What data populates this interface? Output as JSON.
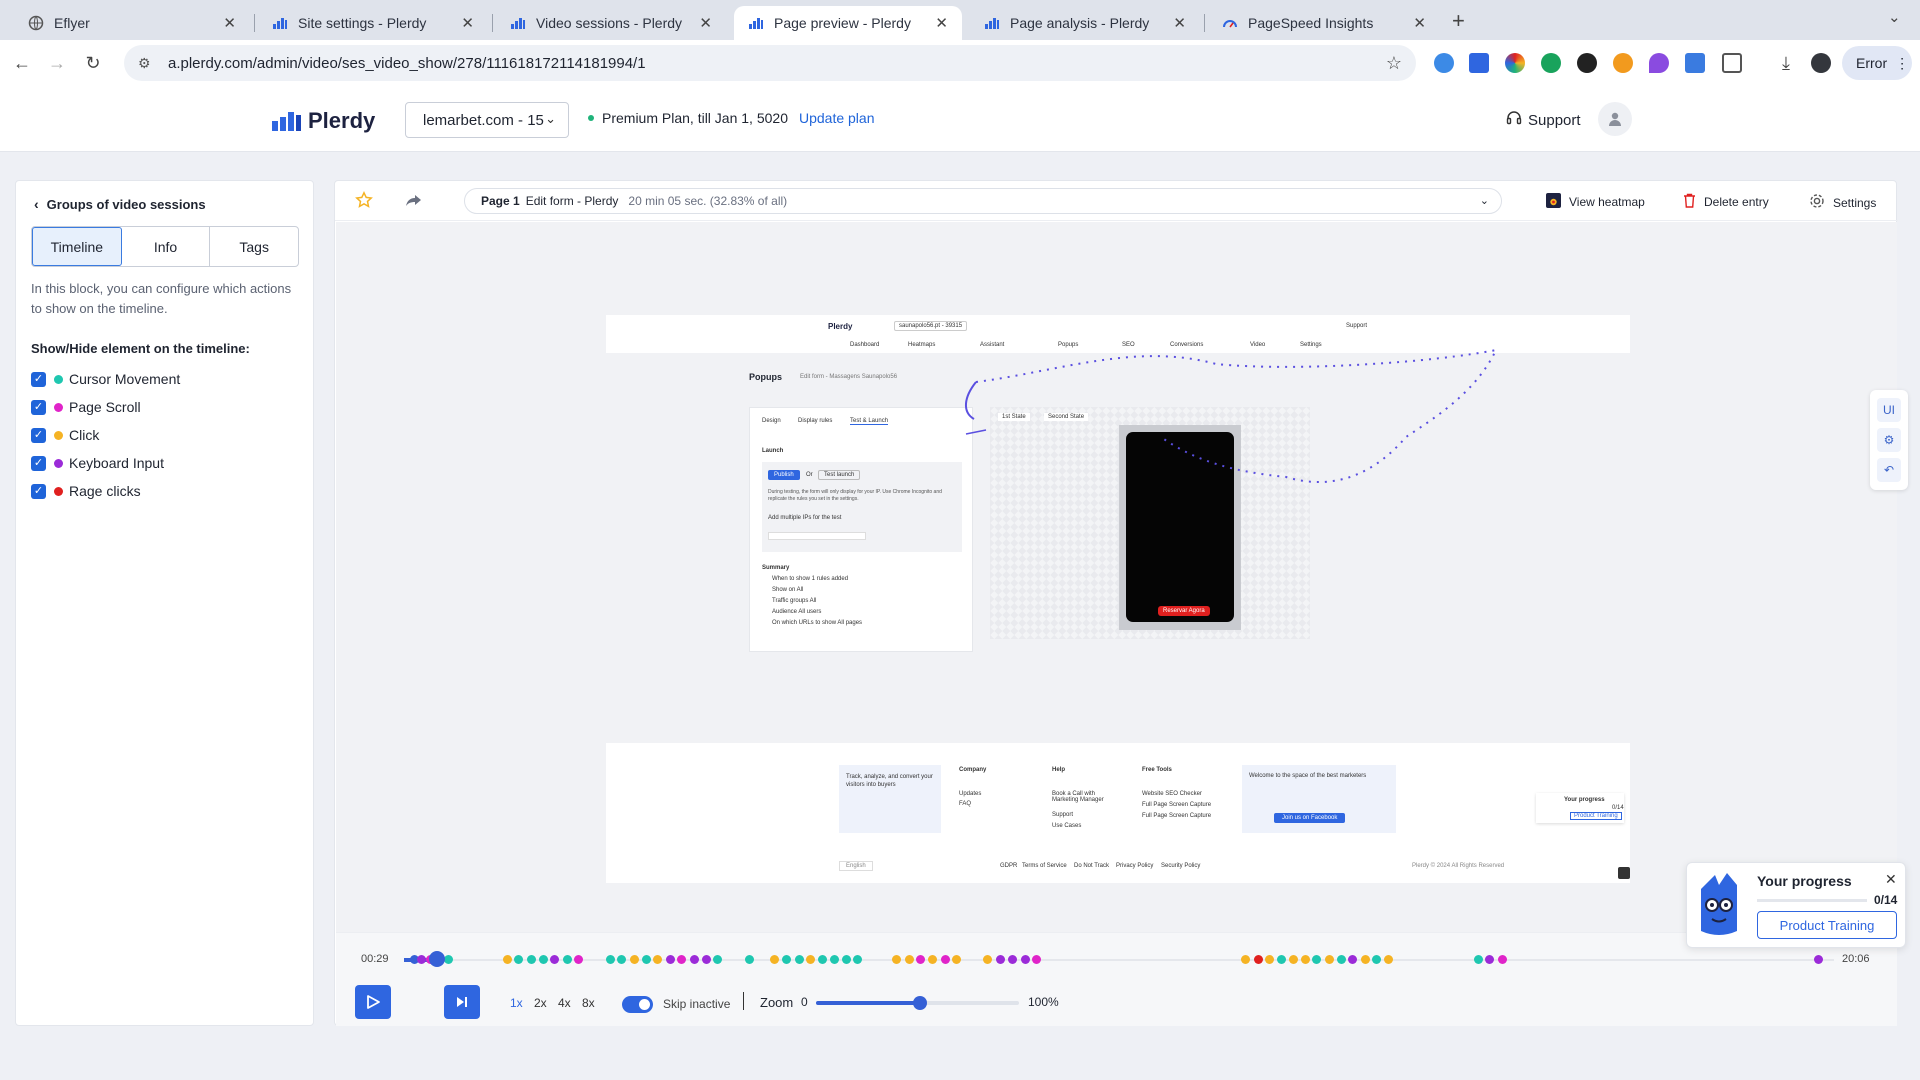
{
  "browser": {
    "tabs": [
      {
        "title": "Eflyer"
      },
      {
        "title": "Site settings - Plerdy"
      },
      {
        "title": "Video sessions - Plerdy"
      },
      {
        "title": "Page preview - Plerdy"
      },
      {
        "title": "Page analysis - Plerdy"
      },
      {
        "title": "PageSpeed Insights"
      }
    ],
    "url": "a.plerdy.com/admin/video/ses_video_show/278/111618172114181994/1",
    "profile_status": "Error"
  },
  "header": {
    "logo": "Plerdy",
    "site": "lemarbet.com - 15",
    "plan": "Premium Plan, till Jan 1, 5020",
    "update_plan": "Update plan",
    "support": "Support"
  },
  "sidebar": {
    "back_label": "Groups of video sessions",
    "tabs": [
      "Timeline",
      "Info",
      "Tags"
    ],
    "description": "In this block, you can configure which actions to show on the timeline.",
    "section_title": "Show/Hide element on the timeline:",
    "items": [
      {
        "label": "Cursor Movement",
        "color": "#1fc7b0"
      },
      {
        "label": "Page Scroll",
        "color": "#e024c9"
      },
      {
        "label": "Click",
        "color": "#f5b324"
      },
      {
        "label": "Keyboard Input",
        "color": "#9b2bd8"
      },
      {
        "label": "Rage clicks",
        "color": "#e0201f"
      }
    ]
  },
  "player": {
    "page_num": "Page 1",
    "page_title": "Edit form - Plerdy",
    "duration": "20 min 05 sec. (32.83% of all)",
    "view_heatmap": "View heatmap",
    "delete_entry": "Delete entry",
    "settings": "Settings",
    "time_current": "00:29",
    "time_total": "20:06",
    "speeds": [
      "1x",
      "2x",
      "4x",
      "8x"
    ],
    "skip_inactive": "Skip inactive",
    "zoom_label": "Zoom",
    "zoom_min": "0",
    "zoom_max": "100%",
    "zoom_level": 0.51,
    "timeline_events": [
      {
        "t": 0.007,
        "c": "#3560d6"
      },
      {
        "t": 0.012,
        "c": "#9b2bd8"
      },
      {
        "t": 0.018,
        "c": "#e024c9"
      },
      {
        "t": 0.031,
        "c": "#1fc7b0"
      },
      {
        "t": 0.072,
        "c": "#f5b324"
      },
      {
        "t": 0.08,
        "c": "#1fc7b0"
      },
      {
        "t": 0.089,
        "c": "#1fc7b0"
      },
      {
        "t": 0.097,
        "c": "#1fc7b0"
      },
      {
        "t": 0.105,
        "c": "#9b2bd8"
      },
      {
        "t": 0.114,
        "c": "#1fc7b0"
      },
      {
        "t": 0.122,
        "c": "#e024c9"
      },
      {
        "t": 0.144,
        "c": "#1fc7b0"
      },
      {
        "t": 0.152,
        "c": "#1fc7b0"
      },
      {
        "t": 0.161,
        "c": "#f5b324"
      },
      {
        "t": 0.169,
        "c": "#1fc7b0"
      },
      {
        "t": 0.177,
        "c": "#f5b324"
      },
      {
        "t": 0.186,
        "c": "#9b2bd8"
      },
      {
        "t": 0.194,
        "c": "#e024c9"
      },
      {
        "t": 0.203,
        "c": "#9b2bd8"
      },
      {
        "t": 0.211,
        "c": "#9b2bd8"
      },
      {
        "t": 0.219,
        "c": "#1fc7b0"
      },
      {
        "t": 0.241,
        "c": "#1fc7b0"
      },
      {
        "t": 0.259,
        "c": "#f5b324"
      },
      {
        "t": 0.267,
        "c": "#1fc7b0"
      },
      {
        "t": 0.276,
        "c": "#1fc7b0"
      },
      {
        "t": 0.284,
        "c": "#f5b324"
      },
      {
        "t": 0.292,
        "c": "#1fc7b0"
      },
      {
        "t": 0.301,
        "c": "#1fc7b0"
      },
      {
        "t": 0.309,
        "c": "#1fc7b0"
      },
      {
        "t": 0.317,
        "c": "#1fc7b0"
      },
      {
        "t": 0.344,
        "c": "#f5b324"
      },
      {
        "t": 0.353,
        "c": "#f5b324"
      },
      {
        "t": 0.361,
        "c": "#e024c9"
      },
      {
        "t": 0.369,
        "c": "#f5b324"
      },
      {
        "t": 0.378,
        "c": "#e024c9"
      },
      {
        "t": 0.386,
        "c": "#f5b324"
      },
      {
        "t": 0.408,
        "c": "#f5b324"
      },
      {
        "t": 0.417,
        "c": "#9b2bd8"
      },
      {
        "t": 0.425,
        "c": "#9b2bd8"
      },
      {
        "t": 0.434,
        "c": "#9b2bd8"
      },
      {
        "t": 0.442,
        "c": "#e024c9"
      },
      {
        "t": 0.588,
        "c": "#f5b324"
      },
      {
        "t": 0.597,
        "c": "#e0201f"
      },
      {
        "t": 0.605,
        "c": "#f5b324"
      },
      {
        "t": 0.613,
        "c": "#1fc7b0"
      },
      {
        "t": 0.622,
        "c": "#f5b324"
      },
      {
        "t": 0.63,
        "c": "#f5b324"
      },
      {
        "t": 0.638,
        "c": "#1fc7b0"
      },
      {
        "t": 0.647,
        "c": "#f5b324"
      },
      {
        "t": 0.655,
        "c": "#1fc7b0"
      },
      {
        "t": 0.663,
        "c": "#9b2bd8"
      },
      {
        "t": 0.672,
        "c": "#f5b324"
      },
      {
        "t": 0.68,
        "c": "#1fc7b0"
      },
      {
        "t": 0.688,
        "c": "#f5b324"
      },
      {
        "t": 0.751,
        "c": "#1fc7b0"
      },
      {
        "t": 0.759,
        "c": "#9b2bd8"
      },
      {
        "t": 0.768,
        "c": "#e024c9"
      },
      {
        "t": 0.989,
        "c": "#9b2bd8"
      }
    ]
  },
  "preview": {
    "logo": "Plerdy",
    "site": "saunapolo56.pt - 39315",
    "support": "Support",
    "nav": [
      "Dashboard",
      "Heatmaps",
      "Assistant",
      "Popups",
      "SEO",
      "Conversions",
      "Video",
      "Settings"
    ],
    "section": "Popups",
    "breadcrumb": "Edit form - Massagens Saunapolo56",
    "form_tabs": [
      "Design",
      "Display rules",
      "Test & Launch"
    ],
    "launch": "Launch",
    "publish": "Publish",
    "or": "Or",
    "test_launch": "Test launch",
    "launch_desc": "During testing, the form will only display for your IP. Use Chrome Incognito and replicate the rules you set in the settings.",
    "multi_ip": "Add multiple IPs for the test",
    "summary": "Summary",
    "summary_items": [
      "When to show 1 rules added",
      "Show on All",
      "Traffic groups All",
      "Audience All users",
      "On which URLs to show All pages"
    ],
    "state_tabs": [
      "1st State",
      "Second State"
    ],
    "cta": "Reservar Agora",
    "footer_promo": "Track, analyze, and convert your visitors into buyers",
    "footer_cols": [
      {
        "title": "Company",
        "links": [
          "Updates",
          "FAQ"
        ]
      },
      {
        "title": "Help",
        "links": [
          "Book a Call with Marketing Manager",
          "Support",
          "Use Cases"
        ]
      },
      {
        "title": "Free Tools",
        "links": [
          "Website SEO Checker",
          "Full Page Screen Capture",
          "Full Page Screen Capture"
        ]
      }
    ],
    "community": "Welcome to the space of the best marketers",
    "join_fb": "Join us on Facebook",
    "lang": "English",
    "legal": [
      "GDPR",
      "Terms of Service",
      "Do Not Track",
      "Privacy Policy",
      "Security Policy"
    ],
    "copyright": "Plerdy © 2024 All Rights Reserved",
    "mini_progress_title": "Your progress",
    "mini_progress_count": "0/14",
    "mini_progress_btn": "Product Training"
  },
  "side_tools": [
    "UI"
  ],
  "progress": {
    "title": "Your progress",
    "count": "0/14",
    "button": "Product Training",
    "fraction": 0
  }
}
